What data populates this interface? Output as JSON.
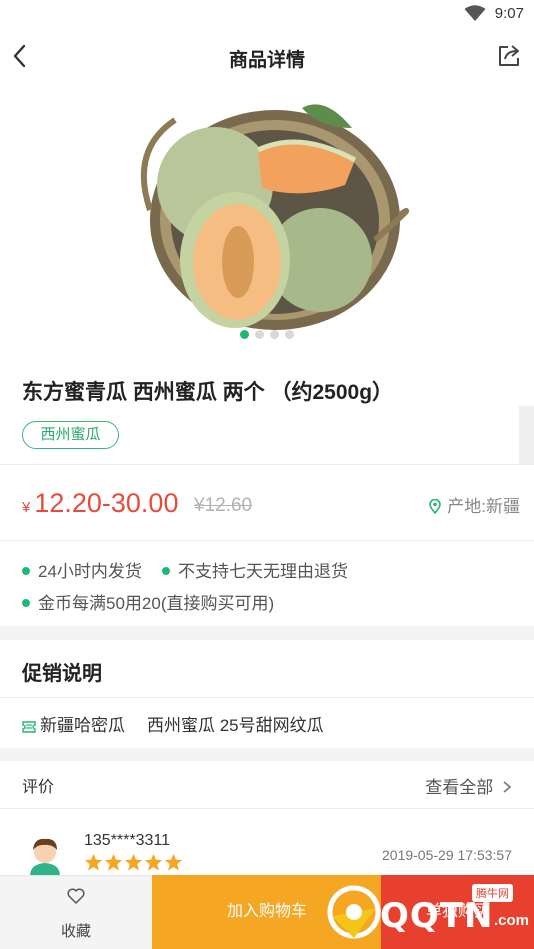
{
  "status_bar": {
    "time": "9:07",
    "wifi_icon": "wifi-icon"
  },
  "header": {
    "title": "商品详情",
    "back_icon": "chevron-left-icon",
    "share_icon": "share-icon"
  },
  "gallery": {
    "image": "melon-product-photo",
    "total_images": 4,
    "active_index": 0
  },
  "product": {
    "title": "东方蜜青瓜  西州蜜瓜 两个 （约2500g）",
    "tag": "西州蜜瓜",
    "currency": "¥",
    "price": "12.20-30.00",
    "original_price": "¥12.60",
    "origin": "产地:新疆"
  },
  "services": [
    "24小时内发货",
    "不支持七天无理由退货",
    "金币每满50用20(直接购买可用)"
  ],
  "promotion": {
    "title": "促销说明",
    "item_a": "新疆哈密瓜",
    "item_b": "西州蜜瓜 25号甜网纹瓜"
  },
  "reviews": {
    "title": "评价",
    "view_all": "查看全部",
    "items": [
      {
        "user": "135****3311",
        "stars": 5,
        "date": "2019-05-29 17:53:57"
      }
    ]
  },
  "bottom_bar": {
    "favorite": "收藏",
    "add_to_cart": "加入购物车",
    "buy_now": "单独购买"
  },
  "watermark": {
    "text": "QQTN",
    "suffix": ".com",
    "tag": "腾牛网"
  },
  "colors": {
    "accent_green": "#22b573",
    "price_red": "#e64c3c",
    "cart_orange": "#f5a623",
    "buy_red": "#e8402f"
  }
}
